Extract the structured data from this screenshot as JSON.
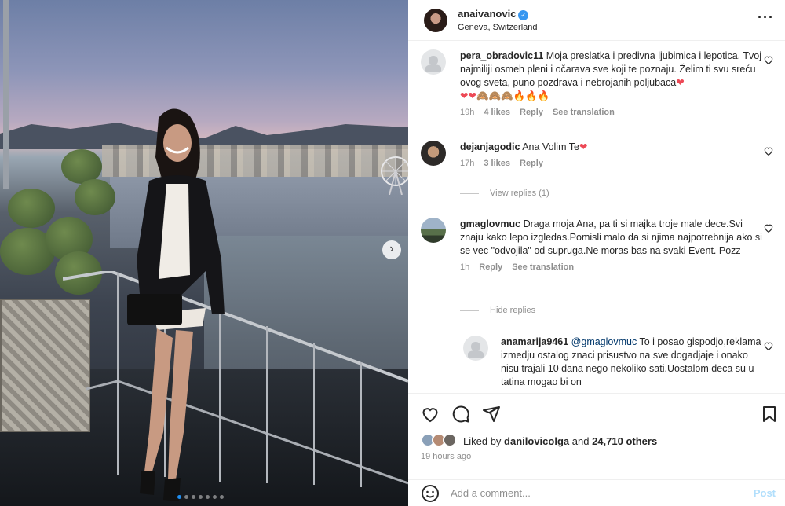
{
  "header": {
    "username": "anaivanovic",
    "verified": true,
    "location": "Geneva, Switzerland",
    "more_icon": "more-horizontal-icon"
  },
  "comments": [
    {
      "user": "pera_obradovic11",
      "text": "Moja preslatka i predivna ljubimica i lepotica. Tvoj najmiliji osmeh pleni i očarava sve koji te poznaju. Želim ti svu sreću ovog sveta, puno pozdrava i nebrojanih poljubaca",
      "text_emoji": "❤",
      "emoji_line": "❤❤🙈🙈🙈🔥🔥🔥",
      "time": "19h",
      "likes": "4 likes",
      "reply": "Reply",
      "translation": "See translation"
    },
    {
      "user": "dejanjagodic",
      "text": "Ana Volim Te",
      "text_emoji": "❤",
      "time": "17h",
      "likes": "3 likes",
      "reply": "Reply",
      "view_replies": "View replies (1)"
    },
    {
      "user": "gmaglovmuc",
      "text": "Draga moja Ana, pa ti si majka troje male dece.Svi znaju kako lepo izgledas.Pomisli malo da si njima najpotrebnija ako si se vec \"odvojila\" od supruga.Ne moras bas na svaki Event. Pozz",
      "time": "1h",
      "reply": "Reply",
      "translation": "See translation",
      "hide_replies": "Hide replies"
    }
  ],
  "reply": {
    "user": "anamarija9461",
    "mention": "@gmaglovmuc",
    "text": "To i posao gispodjo,reklama izmedju ostalog znaci prisustvo na sve dogadjaje i onako nisu trajali 10 dana nego nekoliko sati.Uostalom deca su u tatina mogao bi on"
  },
  "actions": {
    "icons": [
      "heart-icon",
      "comment-icon",
      "share-icon",
      "bookmark-icon"
    ]
  },
  "likes": {
    "prefix": "Liked by",
    "user": "danilovicolga",
    "conjunction": "and",
    "others": "24,710 others"
  },
  "time_ago": "19 hours ago",
  "add_comment": {
    "placeholder": "Add a comment...",
    "post_label": "Post"
  },
  "carousel": {
    "slide_count": 7,
    "active_index": 0
  },
  "colors": {
    "verified_blue": "#3897f0",
    "heart_red": "#ed4956",
    "mention_blue": "#00376b",
    "post_disabled": "#b2dffc",
    "meta_gray": "#8e8e8e"
  }
}
